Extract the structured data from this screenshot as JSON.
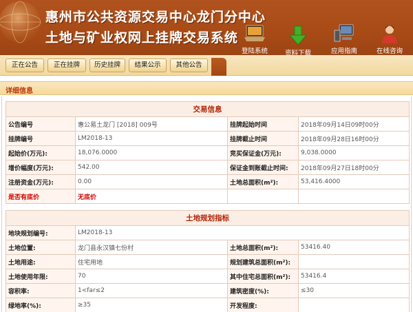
{
  "header": {
    "title_line1": "惠州市公共资源交易中心龙门分中心",
    "title_line2": "土地与矿业权网上挂牌交易系统",
    "icons": [
      {
        "name": "login",
        "label": "登陆系统",
        "icon": "laptop-icon"
      },
      {
        "name": "download",
        "label": "资料下载",
        "icon": "download-arrow-icon"
      },
      {
        "name": "guide",
        "label": "应用指南",
        "icon": "computer-icon"
      },
      {
        "name": "consult",
        "label": "在线咨询",
        "icon": "person-icon"
      }
    ]
  },
  "nav": {
    "items": [
      "正在公告",
      "正在挂牌",
      "历史挂牌",
      "结果公示",
      "其他公告"
    ]
  },
  "section": {
    "title": "详细信息"
  },
  "trade": {
    "caption": "交易信息",
    "rows": [
      [
        "公告编号",
        "惠公易土龙门 [2018] 009号",
        "挂牌起始时间",
        "2018年09月14日09时00分"
      ],
      [
        "挂牌编号",
        "LM2018-13",
        "挂牌截止时间",
        "2018年09月28日16时00分"
      ],
      [
        "起始价(万元):",
        "18,076.0000",
        "竞买保证金(万元):",
        "9,038.0000"
      ],
      [
        "增价幅度(万元):",
        "542.00",
        "保证金到账截止时间:",
        "2018年09月27日18时00分"
      ],
      [
        "注册资金(万元):",
        "0.00",
        "土地总面积(m²):",
        "53,416.4000"
      ]
    ],
    "reserve": {
      "label": "是否有底价",
      "value": "无底价"
    }
  },
  "planning": {
    "caption": "土地规划指标",
    "parcel": {
      "label": "地块规划编号:",
      "value": "LM2018-13"
    },
    "rows": [
      [
        "土地位置:",
        "龙门县永汉镇七份村",
        "土地总面积(m²):",
        "53416.40"
      ],
      [
        "土地用途:",
        "住宅用地",
        "规划建筑总面积(m²):",
        ""
      ],
      [
        "土地使用年限:",
        "70",
        "其中住宅总面积(m²):",
        "53416.4"
      ],
      [
        "容积率:",
        "1<far≤2",
        "建筑密度(%):",
        "≤30"
      ],
      [
        "绿地率(%):",
        "≥35",
        "开发程度:",
        ""
      ]
    ]
  },
  "colors": {
    "header_bg": "#a94b17",
    "nav_bg": "#f3d99f",
    "caption_red": "#b12306",
    "alert_red": "#d20000"
  }
}
